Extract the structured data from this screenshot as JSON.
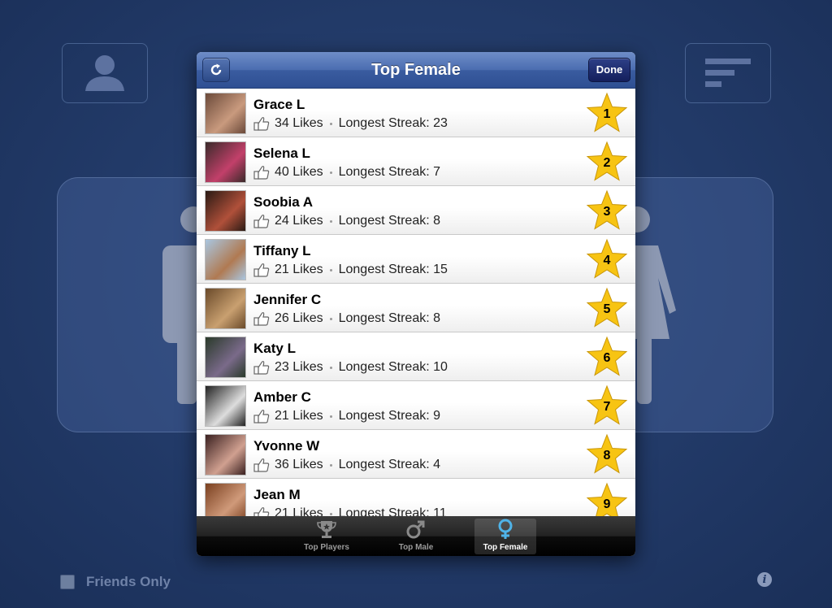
{
  "background": {
    "friends_only_label": "Friends Only"
  },
  "modal": {
    "title": "Top Female",
    "done_label": "Done"
  },
  "players": [
    {
      "name": "Grace L",
      "likes": "34 Likes",
      "streak": "Longest Streak: 23",
      "rank": "1",
      "photo": [
        "#6b4a3a",
        "#c99a7e"
      ]
    },
    {
      "name": "Selena L",
      "likes": "40 Likes",
      "streak": "Longest Streak: 7",
      "rank": "2",
      "photo": [
        "#3a2a2a",
        "#c2406a"
      ]
    },
    {
      "name": "Soobia A",
      "likes": "24 Likes",
      "streak": "Longest Streak: 8",
      "rank": "3",
      "photo": [
        "#2a1a14",
        "#b0503a"
      ]
    },
    {
      "name": "Tiffany L",
      "likes": "21 Likes",
      "streak": "Longest Streak: 15",
      "rank": "4",
      "photo": [
        "#a9c6e0",
        "#b07a52"
      ]
    },
    {
      "name": "Jennifer C",
      "likes": "26 Likes",
      "streak": "Longest Streak: 8",
      "rank": "5",
      "photo": [
        "#6a4a2a",
        "#c9a070"
      ]
    },
    {
      "name": "Katy L",
      "likes": "23 Likes",
      "streak": "Longest Streak: 10",
      "rank": "6",
      "photo": [
        "#2a3a2a",
        "#7a6a8a"
      ]
    },
    {
      "name": "Amber C",
      "likes": "21 Likes",
      "streak": "Longest Streak: 9",
      "rank": "7",
      "photo": [
        "#222222",
        "#dddddd"
      ]
    },
    {
      "name": "Yvonne W",
      "likes": "36 Likes",
      "streak": "Longest Streak: 4",
      "rank": "8",
      "photo": [
        "#3a2020",
        "#d0a090"
      ]
    },
    {
      "name": "Jean M",
      "likes": "21 Likes",
      "streak": "Longest Streak: 11",
      "rank": "9",
      "photo": [
        "#7a4020",
        "#d09a7a"
      ]
    }
  ],
  "tabs": [
    {
      "label": "Top Players",
      "icon": "trophy-icon",
      "active": false
    },
    {
      "label": "Top Male",
      "icon": "male-symbol-icon",
      "active": false
    },
    {
      "label": "Top Female",
      "icon": "female-symbol-icon",
      "active": true
    }
  ],
  "colors": {
    "star_fill": "#f7c413",
    "navbar": "#3a5ca0",
    "active_tab_icon": "#4fb3e8"
  }
}
